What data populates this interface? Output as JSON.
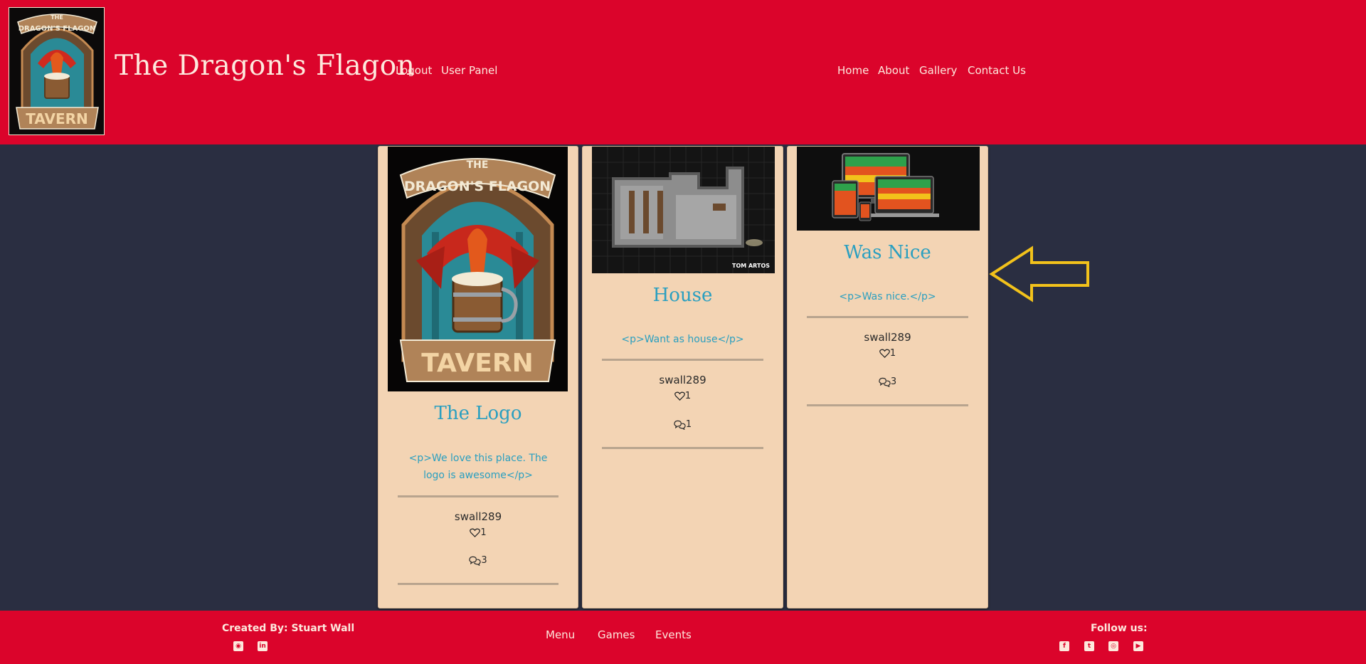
{
  "header": {
    "logo_text_top": "THE",
    "logo_text_mid": "DRAGON'S FLAGON",
    "logo_text_bottom": "TAVERN",
    "site_title": "The Dragon's Flagon",
    "user_links": [
      "Logout",
      "User Panel"
    ],
    "main_nav": [
      "Home",
      "About",
      "Gallery",
      "Contact Us"
    ]
  },
  "posts": [
    {
      "image_text_top": "THE",
      "image_text_mid": "DRAGON'S FLAGON",
      "image_text_bottom": "TAVERN",
      "title": "The Logo",
      "body": "<p>We love this place. The logo is awesome</p>",
      "author": "swall289",
      "likes": "1",
      "comments": "3"
    },
    {
      "image_credit": "TOM ARTOS",
      "title": "House",
      "body": "<p>Want as house</p>",
      "author": "swall289",
      "likes": "1",
      "comments": "1"
    },
    {
      "title": "Was Nice",
      "body": "<p>Was nice.</p>",
      "author": "swall289",
      "likes": "1",
      "comments": "3"
    }
  ],
  "footer": {
    "credit": "Created By: Stuart Wall",
    "links": [
      "Menu",
      "Games",
      "Events"
    ],
    "follow_label": "Follow us:"
  },
  "colors": {
    "brand_red": "#db042b",
    "page_bg": "#2a2e41",
    "card_bg": "#f3d4b4",
    "accent_teal": "#2a9fc0",
    "arrow_yellow": "#f2c21b"
  }
}
